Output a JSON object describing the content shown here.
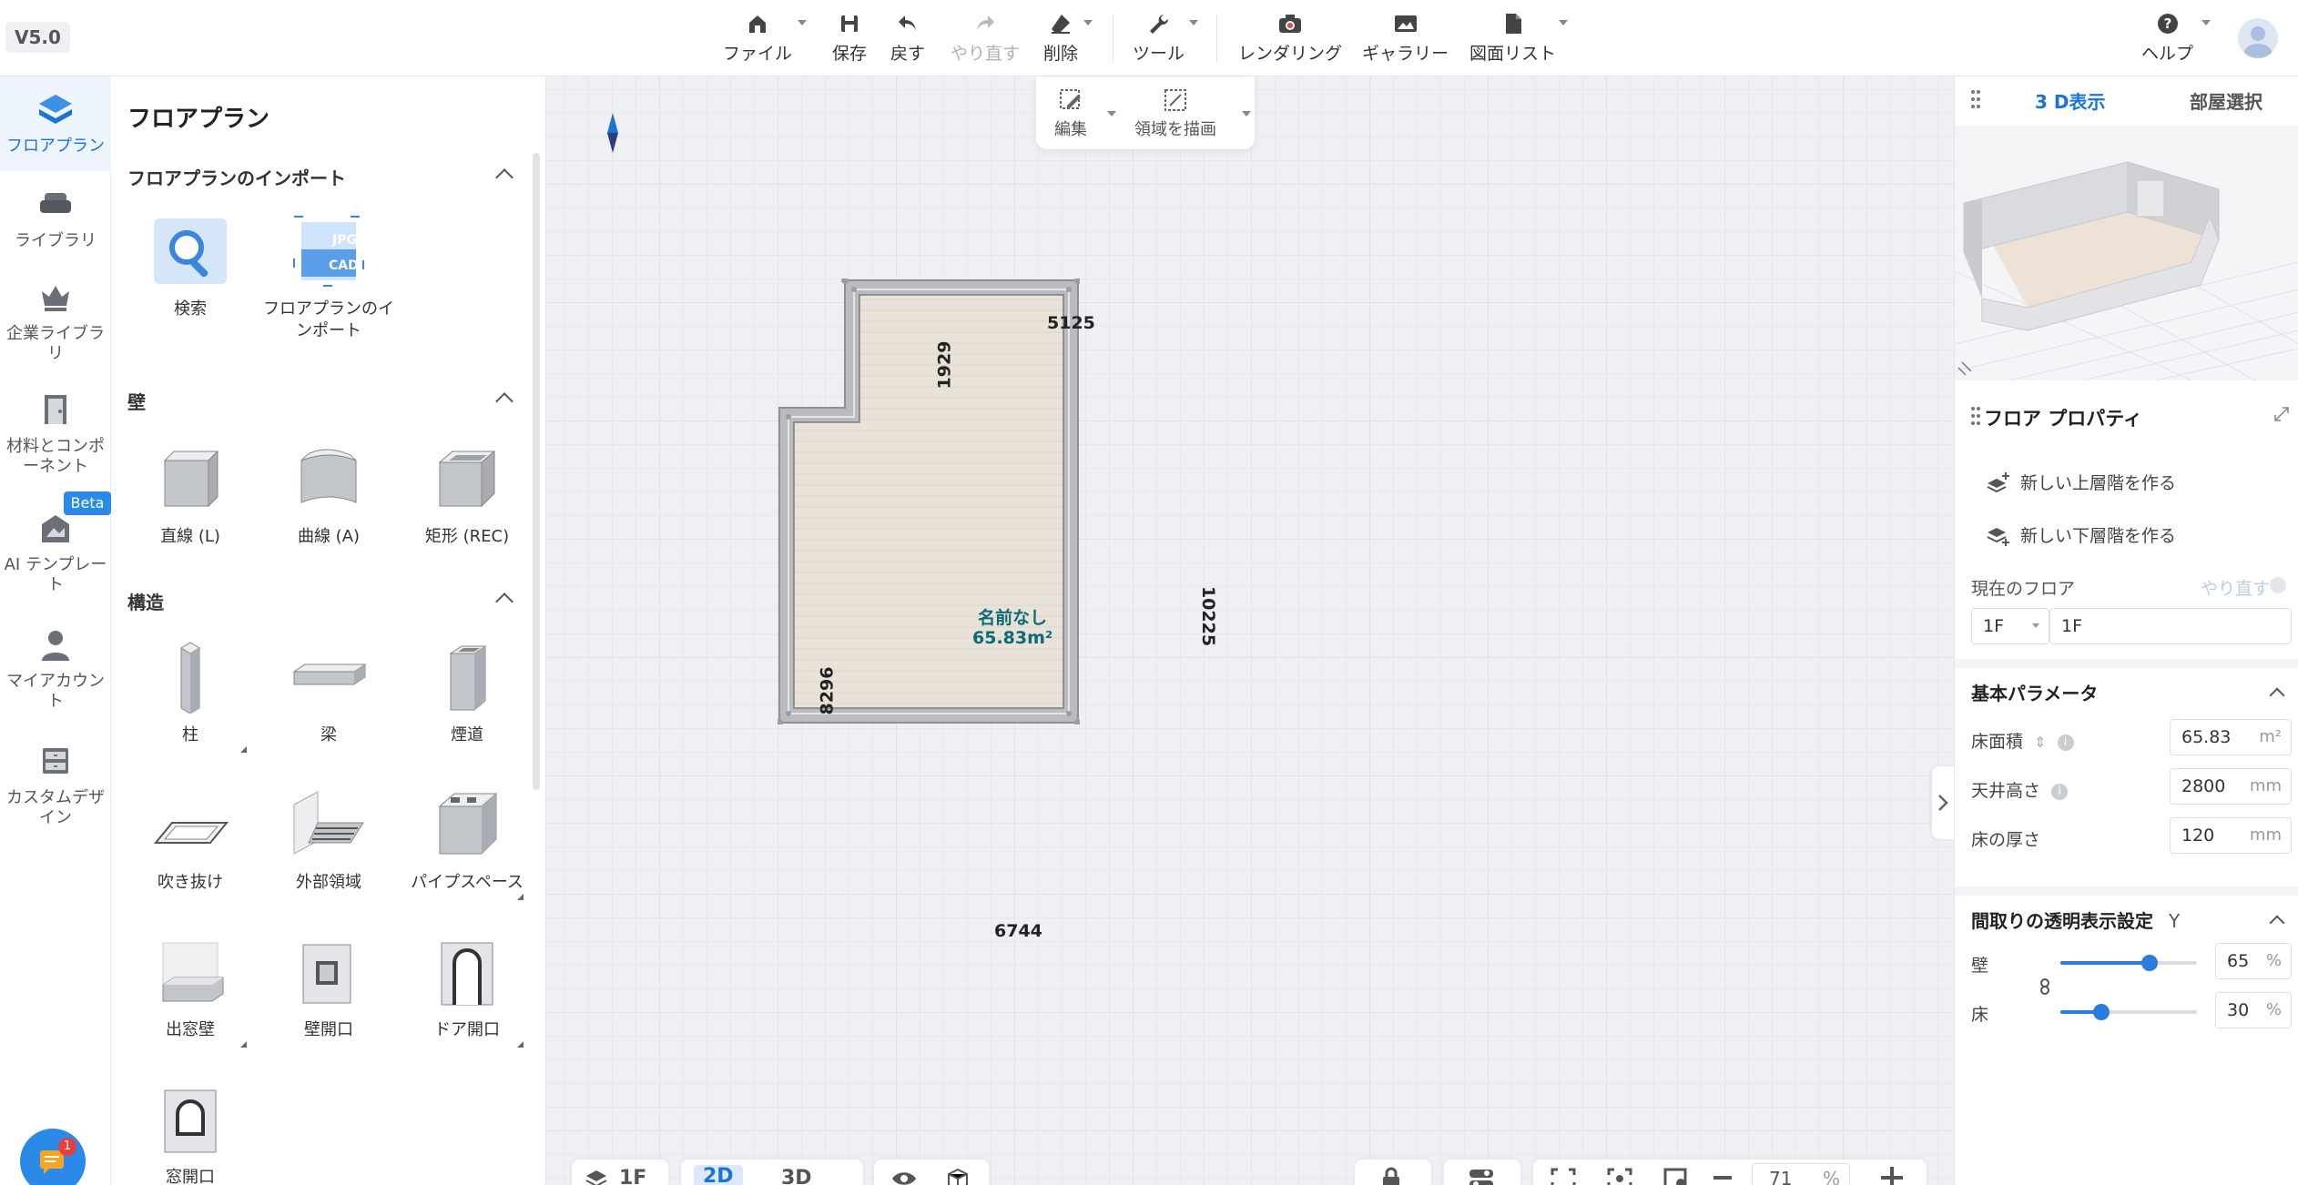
{
  "version": "V5.0",
  "toolbar": {
    "file": "ファイル",
    "save": "保存",
    "undo": "戻す",
    "redo": "やり直す",
    "delete": "削除",
    "tools": "ツール",
    "rendering": "レンダリング",
    "gallery": "ギャラリー",
    "drawing_list": "図面リスト",
    "help": "ヘルプ"
  },
  "rail": [
    {
      "label": "フロアプラン",
      "icon": "floorplan-icon",
      "active": true
    },
    {
      "label": "ライブラリ",
      "icon": "sofa-icon"
    },
    {
      "label": "企業ライブラリ",
      "icon": "crown-icon"
    },
    {
      "label": "材料とコンポーネント",
      "icon": "door-icon"
    },
    {
      "label": "AI テンプレート",
      "icon": "ai-template-icon",
      "badge": "Beta"
    },
    {
      "label": "マイアカウント",
      "icon": "person-icon"
    },
    {
      "label": "カスタムデザイン",
      "icon": "cabinet-icon"
    }
  ],
  "left_panel": {
    "title": "フロアプラン",
    "import_section": {
      "title": "フロアプランのインポート",
      "items": [
        "検索",
        "フロアプランのインポート"
      ],
      "file_labels": [
        "JPG",
        "CAD"
      ]
    },
    "wall_section": {
      "title": "壁",
      "items": [
        "直線 (L)",
        "曲線 (A)",
        "矩形 (REC)"
      ]
    },
    "structure_section": {
      "title": "構造",
      "items": [
        "柱",
        "梁",
        "煙道",
        "吹き抜け",
        "外部領域",
        "パイプスペース",
        "出窓壁",
        "壁開口",
        "ドア開口",
        "窓開口"
      ]
    }
  },
  "canvas": {
    "float_tools": [
      "編集",
      "領域を描画"
    ],
    "room": {
      "name": "名前なし",
      "area": "65.83m²"
    },
    "dimensions": {
      "top": "5125",
      "notch": "1929",
      "left": "8296",
      "right": "10225",
      "bottom": "6744"
    },
    "bottom": {
      "floor": "1F",
      "view2d": "2D",
      "view3d": "3D",
      "zoom": "71",
      "zoom_unit": "%"
    }
  },
  "right_panel": {
    "tabs": [
      "3 D表示",
      "部屋選択"
    ],
    "props_title": "フロア プロパティ",
    "new_upper": "新しい上層階を作る",
    "new_lower": "新しい下層階を作る",
    "current_floor_label": "現在のフロア",
    "redo": "やり直す",
    "floor_select": "1F",
    "floor_name": "1F",
    "basic_params_title": "基本パラメータ",
    "floor_area_label": "床面積",
    "floor_area": "65.83",
    "floor_area_unit": "m²",
    "ceiling_label": "天井高さ",
    "ceiling": "2800",
    "ceiling_unit": "mm",
    "thickness_label": "床の厚さ",
    "thickness": "120",
    "thickness_unit": "mm",
    "transparency_title": "間取りの透明表示設定",
    "transparency_suffix": "Y",
    "wall_label": "壁",
    "wall_value": "65",
    "floor_label": "床",
    "floor_value": "30",
    "percent": "%"
  },
  "notification_count": "1",
  "colors": {
    "accent": "#1a74d6",
    "room_text": "#0b6a78"
  }
}
